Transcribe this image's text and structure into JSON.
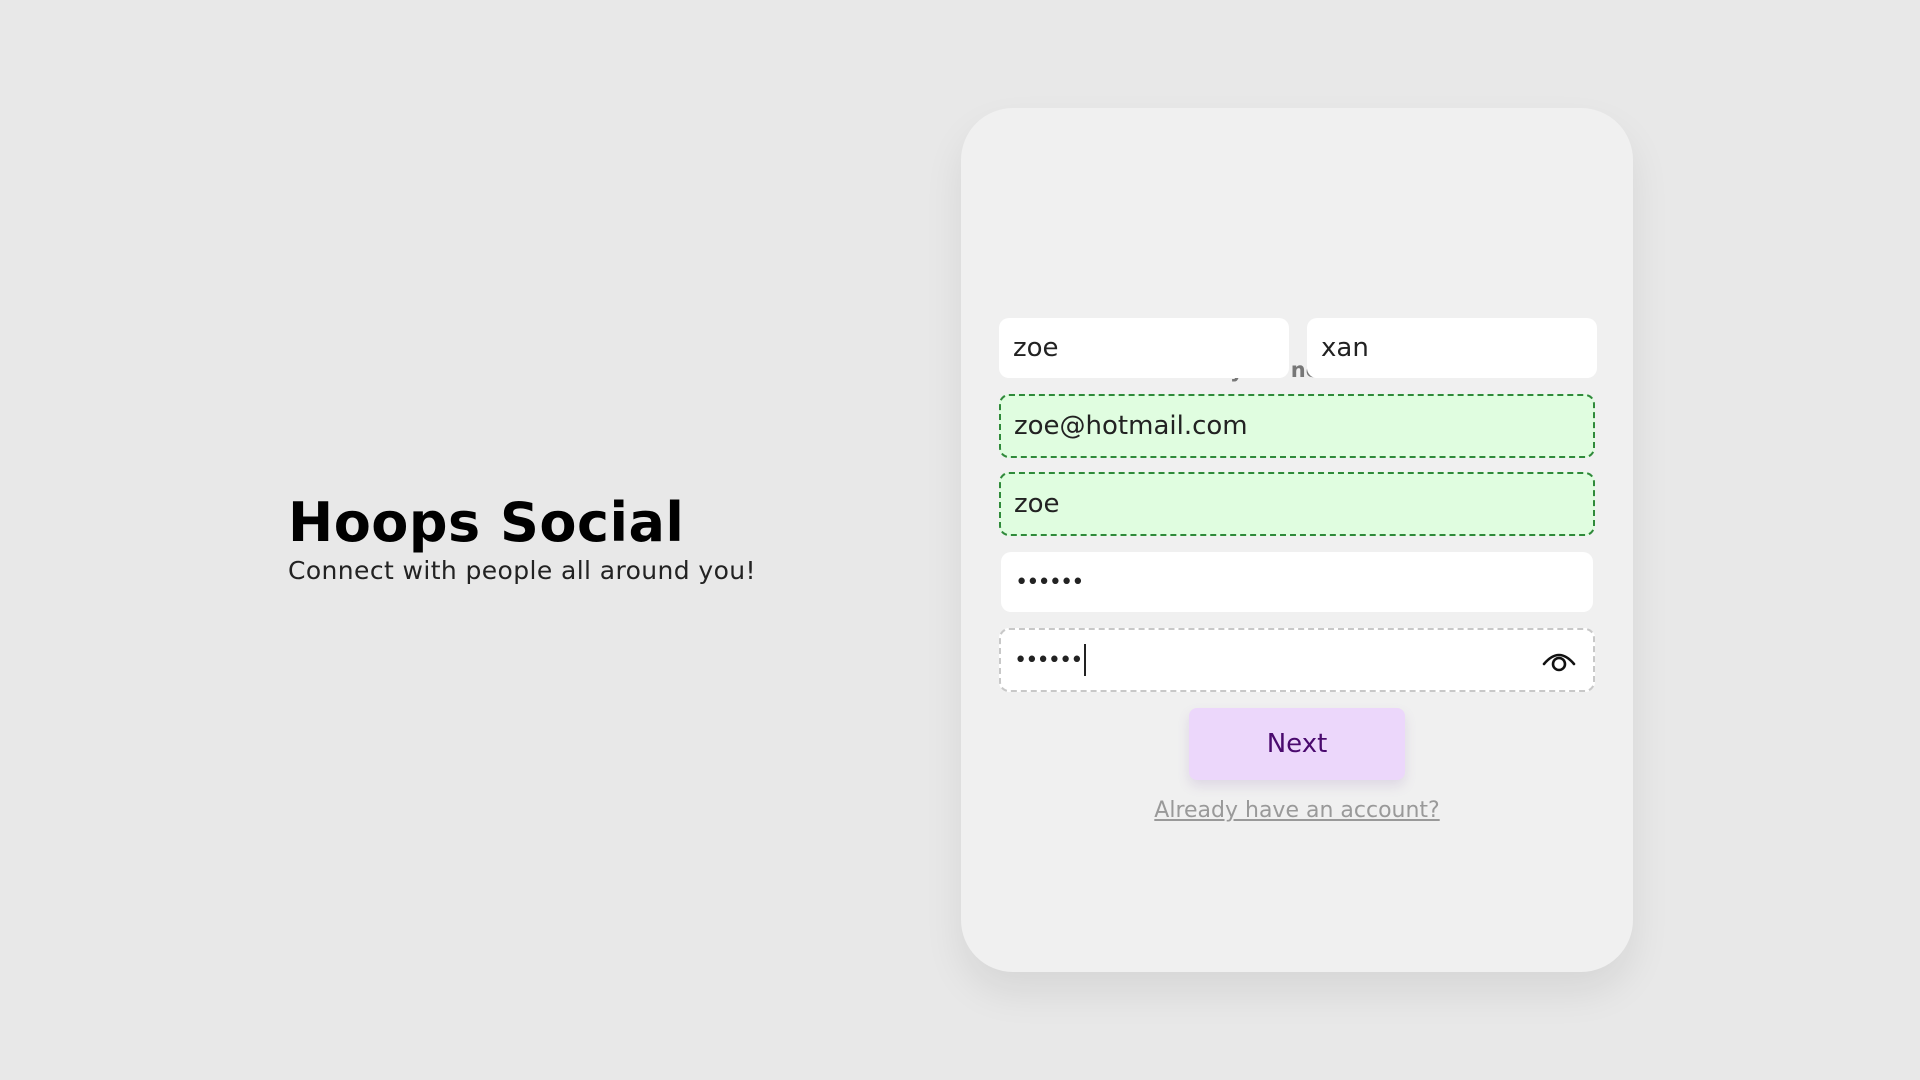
{
  "brand": {
    "title": "Hoops Social",
    "subtitle": "Connect with people all around you!"
  },
  "form": {
    "heading": "Create your new account!",
    "first_name": "zoe",
    "last_name": "xan",
    "email": "zoe@hotmail.com",
    "username": "zoe",
    "password": "••••••",
    "confirm_password": "••••••",
    "next_label": "Next",
    "login_link": "Already have an account?",
    "valid_color": "#2f8a3a",
    "valid_bg": "#e0fde0",
    "button_color": "#ecd7fb",
    "show_password_icon": "eye-icon"
  }
}
